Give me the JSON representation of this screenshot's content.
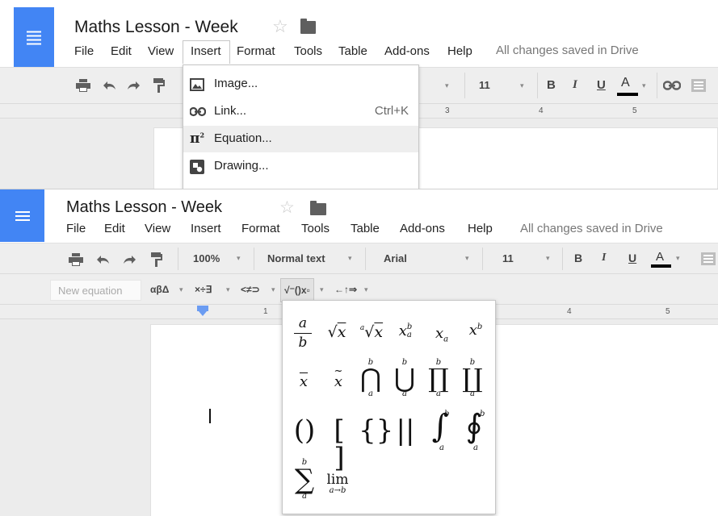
{
  "doc": {
    "title": "Maths Lesson - Week",
    "status": "All changes saved in Drive"
  },
  "menus": [
    "File",
    "Edit",
    "View",
    "Insert",
    "Format",
    "Tools",
    "Table",
    "Add-ons",
    "Help"
  ],
  "insert_menu": {
    "items": [
      {
        "label": "Image...",
        "shortcut": "",
        "icon": "image-icon"
      },
      {
        "label": "Link...",
        "shortcut": "Ctrl+K",
        "icon": "link-icon"
      },
      {
        "label": "Equation...",
        "shortcut": "",
        "icon": "pi-icon"
      },
      {
        "label": "Drawing...",
        "shortcut": "",
        "icon": "drawing-icon"
      }
    ],
    "highlighted_index": 2
  },
  "toolbar": {
    "zoom": "100%",
    "style": "Normal text",
    "font": "Arial",
    "font_size": "11",
    "bold": "B",
    "italic": "I",
    "underline": "U",
    "text_color": "A"
  },
  "equation_bar": {
    "placeholder": "New equation",
    "categories": [
      "αβΔ",
      "×÷∃",
      "<≠⊃",
      "√⁻()x▫",
      "←↑⇒"
    ],
    "active_category_index": 3
  },
  "rulers": {
    "top_numbers": [
      "3",
      "4",
      "5"
    ],
    "bottom_numbers": [
      "1",
      "4",
      "5"
    ]
  },
  "math_symbols": {
    "row1": [
      "fraction",
      "sqrt",
      "nth-root",
      "sub-superscript",
      "subscript",
      "superscript"
    ],
    "row2": [
      "bar",
      "tilde",
      "big-intersection",
      "big-union",
      "big-product",
      "big-coproduct"
    ],
    "row3": [
      "parentheses",
      "brackets",
      "braces",
      "absolute-value",
      "integral",
      "contour-integral"
    ],
    "row4": [
      "summation",
      "limit"
    ],
    "glyphs": {
      "a": "a",
      "b": "b",
      "x": "x",
      "lim": "lim",
      "lim_sub": "a→b"
    }
  },
  "colors": {
    "brand_blue": "#4285f4",
    "toolbar_bg": "#eeeeee",
    "menu_highlight": "#eeeeee",
    "status_gray": "#777777"
  }
}
